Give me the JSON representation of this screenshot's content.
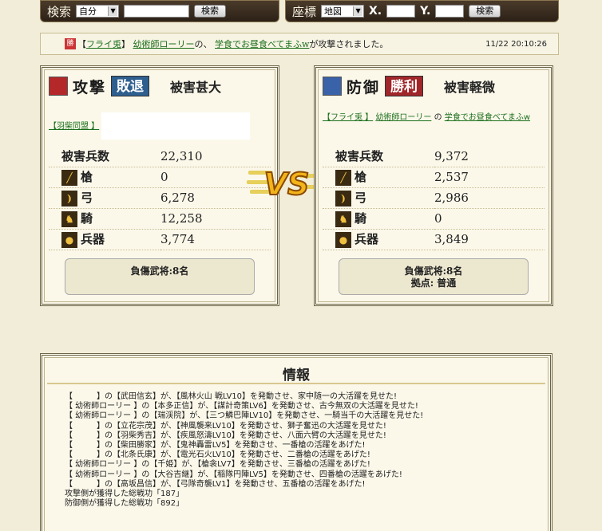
{
  "search": {
    "title": "検索",
    "scope": "自分",
    "button": "検索"
  },
  "coords": {
    "title": "座標",
    "scope": "地図",
    "x_label": "X.",
    "y_label": "Y.",
    "button": "検索"
  },
  "notice": {
    "badge": "勝",
    "bracket_open": "【",
    "alliance": "フライ兎",
    "bracket_close": "】",
    "attacker": "幼術師ローリー",
    "mid": "の、",
    "target": "学食でお昼食べてまふw",
    "suffix": "が攻撃されました。",
    "time": "11/22 20:10:26"
  },
  "attack": {
    "label": "攻撃",
    "result": "敗退",
    "damage": "被害甚大",
    "alliance": "【羽柴同盟 】",
    "casualties_title": "被害兵数",
    "casualties": "22,310",
    "units": [
      {
        "name": "槍",
        "icon": "spear-icon",
        "value": "0"
      },
      {
        "name": "弓",
        "icon": "bow-icon",
        "value": "6,278"
      },
      {
        "name": "騎",
        "icon": "horse-icon",
        "value": "12,258"
      },
      {
        "name": "兵器",
        "icon": "siege-icon",
        "value": "3,774"
      }
    ],
    "wounded": "負傷武将:8名"
  },
  "defense": {
    "label": "防御",
    "result": "勝利",
    "damage": "被害軽微",
    "alliance": "【フライ兎 】",
    "player": "幼術師ローリー",
    "of": "の",
    "village": "学食でお昼食べてまふw",
    "casualties_title": "被害兵数",
    "casualties": "9,372",
    "units": [
      {
        "name": "槍",
        "icon": "spear-icon",
        "value": "2,537"
      },
      {
        "name": "弓",
        "icon": "bow-icon",
        "value": "2,986"
      },
      {
        "name": "騎",
        "icon": "horse-icon",
        "value": "0"
      },
      {
        "name": "兵器",
        "icon": "siege-icon",
        "value": "3,849"
      }
    ],
    "wounded": "負傷武将:8名",
    "base": "拠点: 普通"
  },
  "vs_label": "VS",
  "info": {
    "title": "情報",
    "lines": [
      "【　　　】の【武田信玄】が、【風林火山 戦LV10】を発動させ、家中随一の大活躍を見せた!",
      "【 幼術師ローリー 】の【本多正信】が、【謀計奇策LV6】を発動させ、古今無双の大活躍を見せた!",
      "【 幼術師ローリー 】の【瑞渓院】が、【三つ鱗巴陣LV10】を発動させ、一騎当千の大活躍を見せた!",
      "【　　　】の【立花宗茂】が、【神風襲来LV10】を発動させ、獅子奮迅の大活躍を見せた!",
      "【　　　】の【羽柴秀吉】が、【疾風怒濤LV10】を発動させ、八面六臂の大活躍を見せた!",
      "【　　　】の【柴田勝家】が、【鬼神轟雷LV5】を発動させ、一番槍の活躍をあげた!",
      "【　　　】の【北条氏康】が、【電光石火LV10】を発動させ、二番槍の活躍をあげた!",
      "【 幼術師ローリー 】の【千姫】が、【槍衾LV7】を発動させ、三番槍の活躍をあげた!",
      "【 幼術師ローリー 】の【大谷吉継】が、【稲隊円陣LV5】を発動させ、四番槍の活躍をあげた!",
      "【　　　】の【高坂昌信】が、【弓隊奇襲LV1】を発動させ、五番槍の活躍をあげた!",
      "攻撃側が獲得した総戦功「187」",
      "防御側が獲得した総戦功「892」"
    ]
  },
  "colors": {
    "defeat": "#2f5f8f",
    "victory": "#a0262a",
    "link": "#1a6e1a"
  }
}
